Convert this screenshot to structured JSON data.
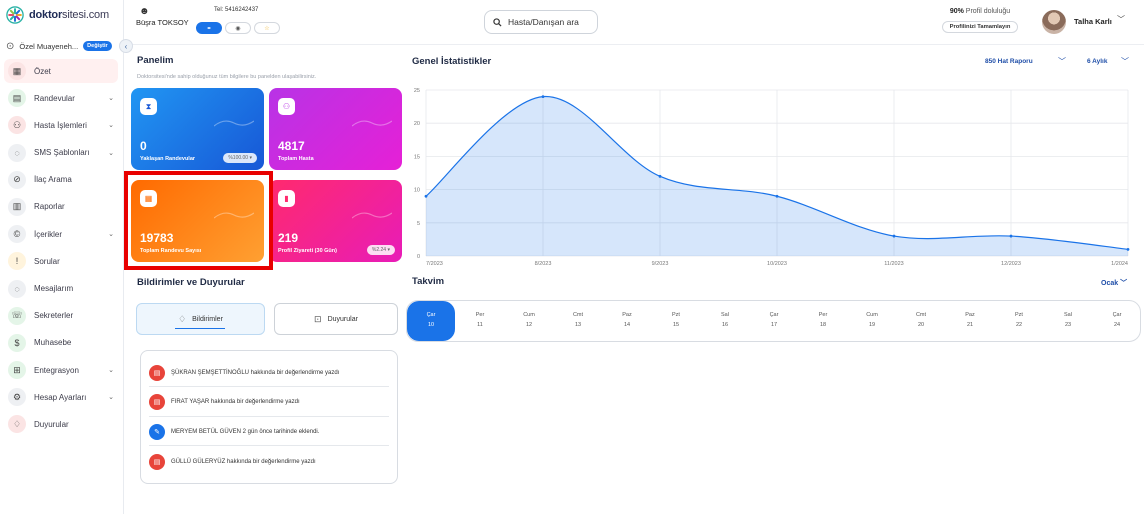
{
  "brand": {
    "bold": "doktor",
    "rest": "sitesi.com"
  },
  "clinic": {
    "name": "Özel Muayeneh...",
    "change_label": "Değiştir"
  },
  "sidebar": {
    "items": [
      {
        "label": "Özet",
        "icon": "dashboard-icon",
        "glyph": "▦",
        "color": "#fbe4e4",
        "active": true,
        "caret": false
      },
      {
        "label": "Randevular",
        "icon": "calendar-icon",
        "glyph": "▤",
        "color": "#e4f5e8",
        "caret": true
      },
      {
        "label": "Hasta İşlemleri",
        "icon": "users-icon",
        "glyph": "⚇",
        "color": "#fbe4e4",
        "caret": true
      },
      {
        "label": "SMS Şablonları",
        "icon": "chat-icon",
        "glyph": "◌",
        "color": "#eef0f3",
        "caret": true
      },
      {
        "label": "İlaç Arama",
        "icon": "pill-icon",
        "glyph": "⊘",
        "color": "#eef0f3",
        "caret": false
      },
      {
        "label": "Raporlar",
        "icon": "report-icon",
        "glyph": "▥",
        "color": "#eef0f3",
        "caret": false
      },
      {
        "label": "İçerikler",
        "icon": "content-icon",
        "glyph": "©",
        "color": "#eef0f3",
        "caret": true
      },
      {
        "label": "Sorular",
        "icon": "question-icon",
        "glyph": "!",
        "color": "#fff4dd",
        "caret": false
      },
      {
        "label": "Mesajlarım",
        "icon": "message-icon",
        "glyph": "◌",
        "color": "#eef0f3",
        "caret": false
      },
      {
        "label": "Sekreterler",
        "icon": "secretary-icon",
        "glyph": "☏",
        "color": "#e4f5e8",
        "caret": false
      },
      {
        "label": "Muhasebe",
        "icon": "accounting-icon",
        "glyph": "$",
        "color": "#e4f5e8",
        "caret": false
      },
      {
        "label": "Entegrasyon",
        "icon": "integration-icon",
        "glyph": "⊞",
        "color": "#e4f5e8",
        "caret": true
      },
      {
        "label": "Hesap Ayarları",
        "icon": "settings-icon",
        "glyph": "⚙",
        "color": "#eef0f3",
        "caret": true
      },
      {
        "label": "Duyurular",
        "icon": "bell-icon",
        "glyph": "♢",
        "color": "#fbe4e4",
        "caret": false
      }
    ]
  },
  "header": {
    "doctor_name": "Büşra TOKSOY",
    "phone": "Tel: 5416242437",
    "search_placeholder": "Hasta/Danışan ara",
    "profile_percent": "90%",
    "profile_text": "Profil doluluğu",
    "profile_button": "Profilinizi Tamamlayın",
    "user_name": "Talha Karlı"
  },
  "panel": {
    "title": "Panelim",
    "subtitle": "Doktorsitesi'nde sahip olduğunuz tüm bilgilere bu panelden ulaşabilirsiniz.",
    "cards": [
      {
        "value": "0",
        "label": "Yaklaşan Randevular",
        "chip": "%100.00",
        "icon": "hourglass-icon"
      },
      {
        "value": "4817",
        "label": "Toplam Hasta",
        "chip": "",
        "icon": "users-icon"
      },
      {
        "value": "19783",
        "label": "Toplam Randevu Sayısı",
        "chip": "",
        "icon": "calendar-icon"
      },
      {
        "value": "219",
        "label": "Profil Ziyareti (30 Gün)",
        "chip": "%2.24",
        "icon": "mouse-icon"
      }
    ]
  },
  "stats": {
    "title": "Genel İstatistikler",
    "report_select": "850 Hat Raporu",
    "period_select": "6 Aylık"
  },
  "chart_data": {
    "type": "area",
    "x": [
      "7/2023",
      "8/2023",
      "9/2023",
      "10/2023",
      "11/2023",
      "12/2023",
      "1/2024"
    ],
    "series": [
      {
        "values": [
          9,
          24,
          12,
          9,
          3,
          3,
          1
        ]
      }
    ],
    "ylim": [
      0,
      25
    ],
    "yticks": [
      0,
      5,
      10,
      15,
      20,
      25
    ],
    "grid": true,
    "color": "#1a73e8"
  },
  "notifications": {
    "title": "Bildirimler ve Duyurular",
    "tab_notifications": "Bildirimler",
    "tab_announcements": "Duyurular",
    "items": [
      {
        "text": "ŞÜKRAN ŞEMŞETTİNOĞLU hakkında bir değerlendirme yazdı",
        "icon": "comment-icon",
        "kind": "red"
      },
      {
        "text": "FIRAT YAŞAR hakkında bir değerlendirme yazdı",
        "icon": "comment-icon",
        "kind": "red"
      },
      {
        "text": "MERYEM BETÜL GÜVEN 2 gün önce tarihinde eklendi.",
        "icon": "edit-icon",
        "kind": "blue"
      },
      {
        "text": "GÜLLÜ GÜLERYÜZ hakkında bir değerlendirme yazdı",
        "icon": "comment-icon",
        "kind": "red"
      }
    ]
  },
  "calendar": {
    "title": "Takvim",
    "month": "Ocak",
    "days": [
      {
        "name": "Çar",
        "date": "10",
        "active": true
      },
      {
        "name": "Per",
        "date": "11"
      },
      {
        "name": "Cum",
        "date": "12"
      },
      {
        "name": "Cmt",
        "date": "13"
      },
      {
        "name": "Paz",
        "date": "14"
      },
      {
        "name": "Pzt",
        "date": "15"
      },
      {
        "name": "Sal",
        "date": "16"
      },
      {
        "name": "Çar",
        "date": "17"
      },
      {
        "name": "Per",
        "date": "18"
      },
      {
        "name": "Cum",
        "date": "19"
      },
      {
        "name": "Cmt",
        "date": "20"
      },
      {
        "name": "Paz",
        "date": "21"
      },
      {
        "name": "Pzt",
        "date": "22"
      },
      {
        "name": "Sal",
        "date": "23"
      },
      {
        "name": "Çar",
        "date": "24"
      }
    ]
  }
}
